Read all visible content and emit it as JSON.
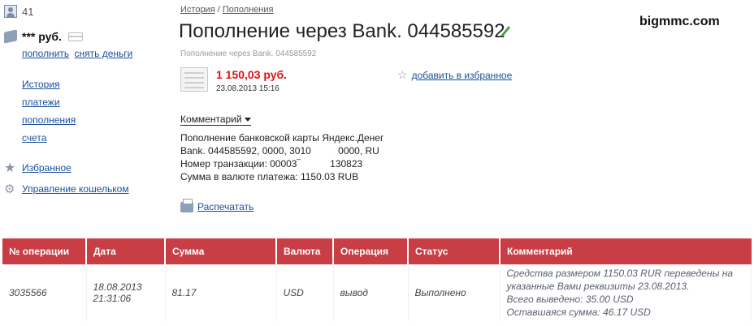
{
  "user": {
    "id": "41"
  },
  "wallet": {
    "balance": "*** руб.",
    "topup_label": "пополнить",
    "withdraw_label": "снять деньги"
  },
  "side_menu": [
    {
      "label": "История"
    },
    {
      "label": "платежи"
    },
    {
      "label": "пополнения"
    },
    {
      "label": "счета"
    }
  ],
  "favorites_label": "Избранное",
  "wallet_manage_label": "Управление кошельком",
  "breadcrumb": {
    "history": "История",
    "separator": " / ",
    "topups": "Пополнения"
  },
  "title": "Пополнение через Bank. 044585592",
  "subtitle": "Пополнение через Bank. 044585592",
  "operation": {
    "amount": "1 150,03 руб.",
    "datetime": "23.08.2013 15:16"
  },
  "add_favorite_label": "добавить в избранное",
  "comment": {
    "toggle_label": "Комментарий",
    "lines": [
      "Пополнение банковской карты Яндекс.Денег",
      "Bank. 044585592, 0000, 3010          0000, RU",
      "Номер транзакции: 00003‾           130823",
      "Сумма в валюте платежа: 1150.03 RUB"
    ]
  },
  "print_label": "Распечатать",
  "watermark": "bigmmc.com",
  "table": {
    "headers": [
      "№ операции",
      "Дата",
      "Сумма",
      "Валюта",
      "Операция",
      "Статус",
      "Комментарий"
    ],
    "rows": [
      {
        "id": "3035566",
        "date": "18.08.2013",
        "time": "21:31:06",
        "sum": "81.17",
        "currency": "USD",
        "operation": "вывод",
        "status": "Выполнено",
        "comment_lines": [
          "Средства размером 1150.03 RUR переведены на",
          "указанные Вами реквизиты 23.08.2013.",
          "Всего выведено: 35.00 USD",
          "Оставшаяся сумма: 46.17 USD"
        ]
      }
    ]
  },
  "colors": {
    "accent_red": "#c93e45",
    "amount_red": "#e01010",
    "link_blue": "#1a4e9c"
  }
}
